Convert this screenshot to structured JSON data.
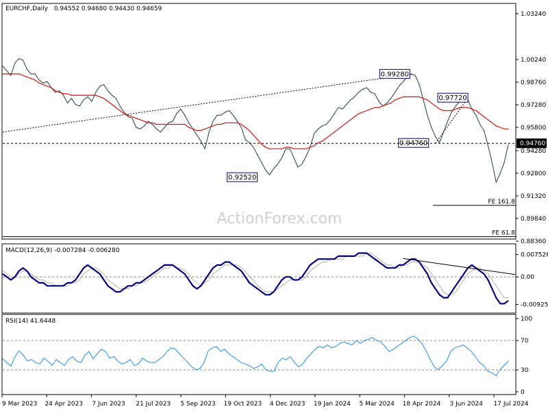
{
  "header": {
    "symbol": "EURCHF,Daily",
    "ohlc": "0.94552 0.94680 0.94430 0.94659",
    "macd_label": "MACD(12,26,9) -0.007284 -0.006280",
    "rsi_label": "RSI(14) 41.6448"
  },
  "watermark": "ActionForex.com",
  "colors": {
    "price": "#2f4f4f",
    "ma": "#e01010",
    "macd": "#000080",
    "signal": "#b0b0b0",
    "rsi": "#1e90ff",
    "trendline": "#000000",
    "label_border": "#000080"
  },
  "chart_data": [
    {
      "type": "line",
      "panel": "price",
      "yticks": [
        "1.03240",
        "1.00240",
        "0.98760",
        "0.97280",
        "0.95800",
        "0.94280",
        "0.92800",
        "0.91320",
        "0.89840",
        "0.88360"
      ],
      "ylim": [
        0.8836,
        1.0324
      ],
      "current_price": {
        "label": "0.94760",
        "value": 0.9476
      },
      "annotations": [
        {
          "label": "0.99280",
          "value": 0.9928
        },
        {
          "label": "0.97720",
          "value": 0.9772
        },
        {
          "label": "0.94760",
          "value": 0.9476
        },
        {
          "label": "0.92520",
          "value": 0.9252
        }
      ],
      "fib_levels": [
        {
          "label": "FE 161.8",
          "value": 0.907
        },
        {
          "label": "FE 61.8",
          "value": 0.8865
        }
      ],
      "series": [
        {
          "role": "price",
          "values": [
            0.998,
            0.995,
            0.992,
            1.0,
            1.003,
            1.002,
            0.996,
            0.993,
            0.993,
            0.989,
            0.987,
            0.988,
            0.984,
            0.981,
            0.982,
            0.979,
            0.974,
            0.977,
            0.973,
            0.972,
            0.976,
            0.978,
            0.975,
            0.981,
            0.985,
            0.986,
            0.982,
            0.979,
            0.977,
            0.972,
            0.968,
            0.965,
            0.964,
            0.958,
            0.957,
            0.959,
            0.962,
            0.96,
            0.957,
            0.955,
            0.958,
            0.961,
            0.962,
            0.967,
            0.97,
            0.966,
            0.961,
            0.957,
            0.953,
            0.949,
            0.944,
            0.955,
            0.962,
            0.966,
            0.966,
            0.968,
            0.969,
            0.966,
            0.962,
            0.958,
            0.95,
            0.948,
            0.945,
            0.94,
            0.935,
            0.93,
            0.927,
            0.931,
            0.934,
            0.938,
            0.944,
            0.944,
            0.938,
            0.932,
            0.934,
            0.939,
            0.945,
            0.954,
            0.957,
            0.959,
            0.96,
            0.963,
            0.967,
            0.971,
            0.97,
            0.973,
            0.976,
            0.978,
            0.981,
            0.983,
            0.984,
            0.981,
            0.98,
            0.975,
            0.972,
            0.974,
            0.977,
            0.981,
            0.985,
            0.988,
            0.991,
            0.993,
            0.992,
            0.986,
            0.976,
            0.966,
            0.958,
            0.952,
            0.948,
            0.955,
            0.962,
            0.968,
            0.972,
            0.975,
            0.977,
            0.976,
            0.97,
            0.966,
            0.96,
            0.956,
            0.946,
            0.935,
            0.922,
            0.928,
            0.935,
            0.94659
          ]
        },
        {
          "role": "ma",
          "values": [
            0.993,
            0.993,
            0.993,
            0.993,
            0.993,
            0.992,
            0.991,
            0.99,
            0.989,
            0.987,
            0.986,
            0.985,
            0.984,
            0.982,
            0.981,
            0.98,
            0.98,
            0.979,
            0.979,
            0.979,
            0.979,
            0.979,
            0.979,
            0.979,
            0.978,
            0.977,
            0.975,
            0.973,
            0.971,
            0.969,
            0.967,
            0.966,
            0.965,
            0.964,
            0.963,
            0.962,
            0.961,
            0.961,
            0.96,
            0.96,
            0.96,
            0.96,
            0.96,
            0.96,
            0.96,
            0.96,
            0.958,
            0.957,
            0.956,
            0.956,
            0.957,
            0.958,
            0.959,
            0.96,
            0.96,
            0.961,
            0.961,
            0.961,
            0.961,
            0.96,
            0.958,
            0.956,
            0.953,
            0.95,
            0.947,
            0.945,
            0.944,
            0.944,
            0.944,
            0.944,
            0.945,
            0.945,
            0.944,
            0.944,
            0.944,
            0.944,
            0.945,
            0.946,
            0.948,
            0.949,
            0.951,
            0.953,
            0.955,
            0.957,
            0.959,
            0.961,
            0.963,
            0.965,
            0.967,
            0.968,
            0.969,
            0.97,
            0.971,
            0.971,
            0.972,
            0.973,
            0.974,
            0.976,
            0.977,
            0.978,
            0.978,
            0.978,
            0.978,
            0.978,
            0.977,
            0.976,
            0.974,
            0.972,
            0.97,
            0.969,
            0.969,
            0.969,
            0.97,
            0.971,
            0.971,
            0.971,
            0.97,
            0.969,
            0.967,
            0.965,
            0.963,
            0.961,
            0.959,
            0.958,
            0.957,
            0.957
          ]
        }
      ]
    },
    {
      "type": "line",
      "panel": "macd",
      "yticks": [
        "0.007526",
        "0.00",
        "-0.009252"
      ],
      "ylim": [
        -0.011,
        0.0095
      ],
      "series": [
        {
          "role": "macd",
          "values": [
            0.001,
            0.0,
            -0.001,
            0.0,
            0.002,
            0.003,
            0.002,
            0.0,
            -0.001,
            -0.002,
            -0.002,
            -0.003,
            -0.003,
            -0.003,
            -0.003,
            -0.003,
            -0.002,
            -0.002,
            -0.001,
            0.001,
            0.003,
            0.004,
            0.003,
            0.002,
            0.001,
            -0.001,
            -0.003,
            -0.004,
            -0.005,
            -0.005,
            -0.004,
            -0.003,
            -0.003,
            -0.002,
            -0.002,
            -0.001,
            0.0,
            0.001,
            0.002,
            0.003,
            0.004,
            0.004,
            0.004,
            0.003,
            0.002,
            0.001,
            -0.001,
            -0.003,
            -0.004,
            -0.003,
            -0.001,
            0.001,
            0.003,
            0.004,
            0.004,
            0.005,
            0.005,
            0.004,
            0.003,
            0.002,
            0.0,
            -0.002,
            -0.003,
            -0.004,
            -0.005,
            -0.006,
            -0.006,
            -0.005,
            -0.003,
            -0.001,
            0.0,
            0.0,
            -0.001,
            -0.001,
            0.0,
            0.002,
            0.004,
            0.005,
            0.006,
            0.006,
            0.006,
            0.006,
            0.006,
            0.007,
            0.007,
            0.007,
            0.007,
            0.007,
            0.008,
            0.008,
            0.008,
            0.007,
            0.006,
            0.005,
            0.004,
            0.003,
            0.003,
            0.003,
            0.004,
            0.004,
            0.005,
            0.006,
            0.006,
            0.005,
            0.003,
            0.001,
            -0.002,
            -0.004,
            -0.006,
            -0.007,
            -0.007,
            -0.005,
            -0.003,
            -0.001,
            0.001,
            0.003,
            0.004,
            0.003,
            0.002,
            0.001,
            -0.001,
            -0.004,
            -0.007,
            -0.009,
            -0.009,
            -0.008
          ]
        },
        {
          "role": "signal",
          "values": [
            0.002,
            0.001,
            0.0,
            0.0,
            0.001,
            0.002,
            0.002,
            0.001,
            0.0,
            -0.001,
            -0.001,
            -0.002,
            -0.002,
            -0.003,
            -0.003,
            -0.003,
            -0.003,
            -0.002,
            -0.002,
            -0.001,
            0.001,
            0.002,
            0.003,
            0.003,
            0.002,
            0.001,
            -0.001,
            -0.002,
            -0.003,
            -0.004,
            -0.004,
            -0.004,
            -0.003,
            -0.003,
            -0.002,
            -0.002,
            -0.001,
            0.0,
            0.001,
            0.002,
            0.003,
            0.003,
            0.004,
            0.003,
            0.003,
            0.002,
            0.001,
            -0.001,
            -0.002,
            -0.003,
            -0.002,
            -0.001,
            0.001,
            0.002,
            0.003,
            0.004,
            0.004,
            0.004,
            0.004,
            0.003,
            0.002,
            0.0,
            -0.001,
            -0.003,
            -0.004,
            -0.005,
            -0.005,
            -0.005,
            -0.004,
            -0.003,
            -0.002,
            -0.001,
            -0.001,
            -0.001,
            -0.001,
            0.0,
            0.002,
            0.003,
            0.004,
            0.005,
            0.005,
            0.006,
            0.006,
            0.006,
            0.006,
            0.007,
            0.007,
            0.007,
            0.007,
            0.007,
            0.008,
            0.008,
            0.007,
            0.006,
            0.005,
            0.004,
            0.004,
            0.003,
            0.003,
            0.004,
            0.004,
            0.005,
            0.005,
            0.005,
            0.004,
            0.003,
            0.001,
            -0.001,
            -0.003,
            -0.005,
            -0.006,
            -0.006,
            -0.005,
            -0.003,
            -0.001,
            0.001,
            0.002,
            0.003,
            0.003,
            0.002,
            0.001,
            -0.001,
            -0.003,
            -0.005,
            -0.007,
            -0.007
          ]
        }
      ],
      "trendline_values": {
        "start_index": 99,
        "end_index": 125,
        "start": 0.0062,
        "end": 0.0008
      }
    },
    {
      "type": "line",
      "panel": "rsi",
      "yticks": [
        "100",
        "70",
        "30",
        "0"
      ],
      "ylim": [
        0,
        100
      ],
      "guides": [
        70,
        30
      ],
      "series": [
        {
          "role": "rsi",
          "values": [
            45,
            40,
            35,
            48,
            56,
            50,
            42,
            44,
            40,
            38,
            46,
            42,
            36,
            44,
            40,
            36,
            44,
            48,
            42,
            40,
            50,
            55,
            45,
            52,
            58,
            55,
            46,
            48,
            42,
            38,
            40,
            44,
            36,
            38,
            46,
            42,
            40,
            40,
            44,
            48,
            55,
            60,
            58,
            52,
            46,
            40,
            34,
            30,
            32,
            40,
            56,
            60,
            62,
            55,
            58,
            52,
            48,
            44,
            40,
            38,
            36,
            32,
            34,
            38,
            30,
            28,
            28,
            40,
            46,
            44,
            48,
            40,
            34,
            38,
            46,
            52,
            58,
            62,
            60,
            64,
            60,
            62,
            66,
            68,
            66,
            64,
            70,
            66,
            70,
            72,
            74,
            70,
            68,
            62,
            55,
            58,
            62,
            66,
            70,
            74,
            76,
            72,
            66,
            56,
            44,
            34,
            30,
            36,
            42,
            55,
            60,
            62,
            64,
            60,
            55,
            48,
            40,
            36,
            28,
            26,
            22,
            30,
            36,
            42
          ]
        }
      ]
    }
  ],
  "x_axis": {
    "labels": [
      "9 Mar 2023",
      "24 Apr 2023",
      "7 Jun 2023",
      "21 Jul 2023",
      "5 Sep 2023",
      "19 Oct 2023",
      "4 Dec 2023",
      "19 Jan 2024",
      "5 Mar 2024",
      "18 Apr 2024",
      "3 Jun 2024",
      "17 Jul 2024"
    ]
  }
}
